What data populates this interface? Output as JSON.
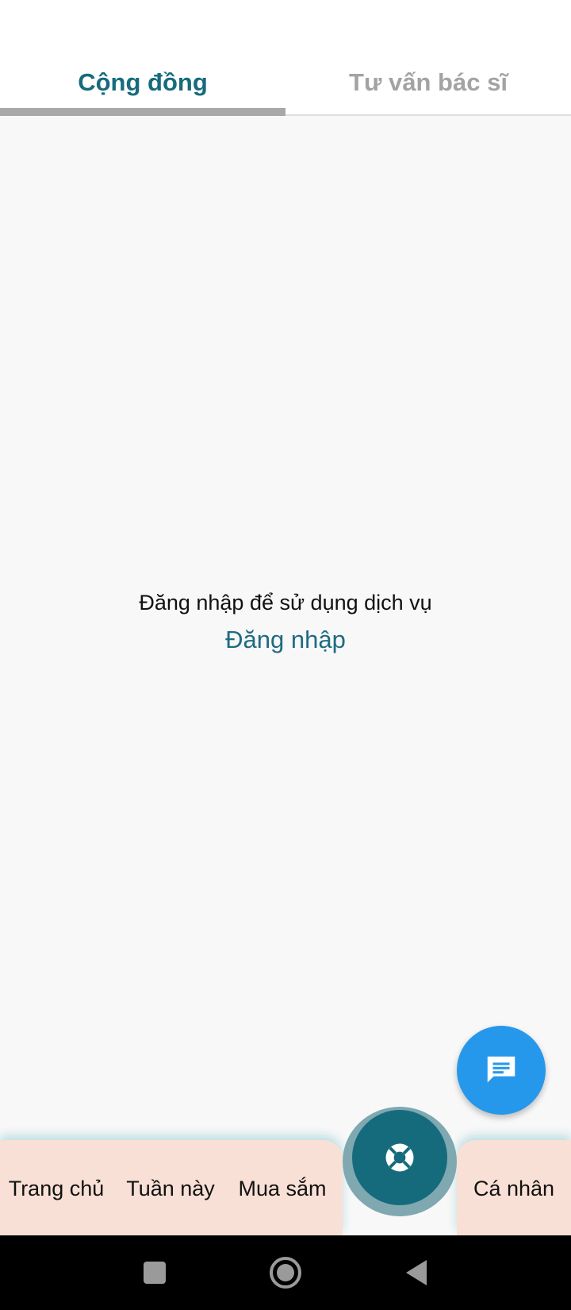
{
  "tabs": [
    {
      "label": "Cộng đồng",
      "active": true
    },
    {
      "label": "Tư vấn bác sĩ",
      "active": false
    }
  ],
  "content": {
    "message": "Đăng nhập để sử dụng dịch vụ",
    "login_link": "Đăng nhập"
  },
  "fab": {
    "icon": "chat-icon"
  },
  "bottom_nav": {
    "items": [
      {
        "label": "Trang chủ"
      },
      {
        "label": "Tuần này"
      },
      {
        "label": "Mua sắm"
      },
      {
        "label": "Cá nhân"
      }
    ],
    "center_icon": "lifebuoy-icon"
  },
  "colors": {
    "accent": "#166b7d",
    "fab": "#2698ec",
    "nav_background": "#f9e0d6",
    "inactive_tab": "#a3a3a3",
    "link": "#1f6b82"
  },
  "system_nav": {
    "buttons": [
      "recents-icon",
      "home-icon",
      "back-icon"
    ]
  }
}
